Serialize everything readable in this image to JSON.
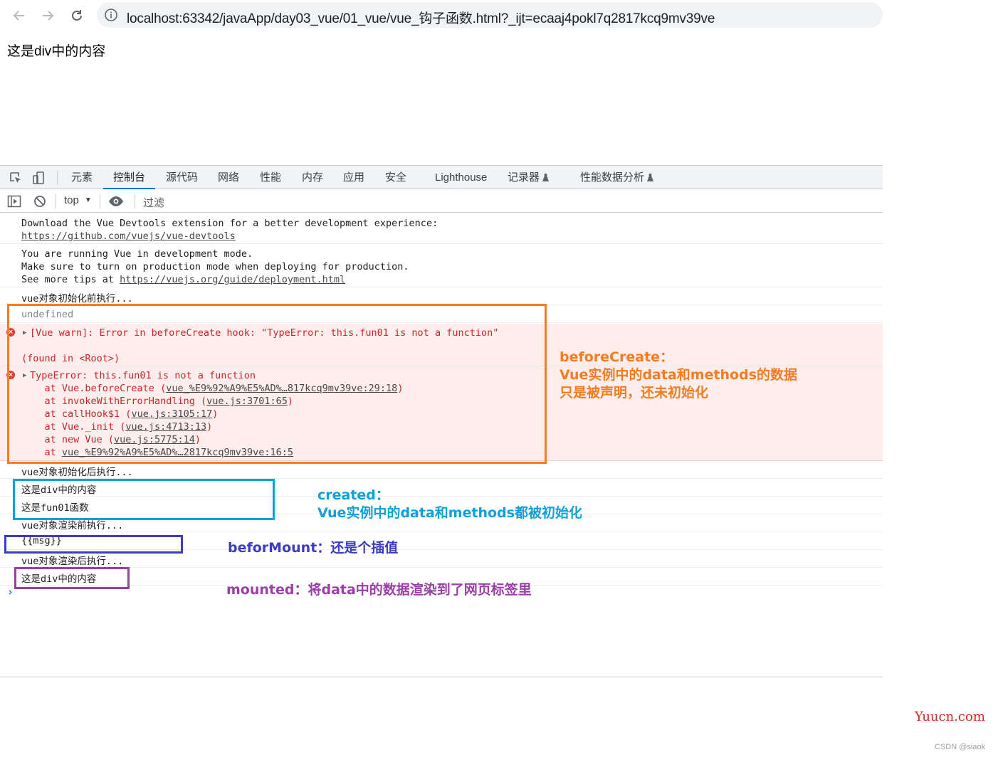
{
  "browser": {
    "url": "localhost:63342/javaApp/day03_vue/01_vue/vue_钩子函数.html?_ijt=ecaaj4pokl7q2817kcq9mv39ve"
  },
  "page": {
    "content": "这是div中的内容"
  },
  "devtools": {
    "tabs": [
      {
        "label": "元素"
      },
      {
        "label": "控制台"
      },
      {
        "label": "源代码"
      },
      {
        "label": "网络"
      },
      {
        "label": "性能"
      },
      {
        "label": "内存"
      },
      {
        "label": "应用"
      },
      {
        "label": "安全"
      },
      {
        "label": "Lighthouse"
      },
      {
        "label": "记录器"
      },
      {
        "label": "性能数据分析"
      }
    ],
    "active_tab": "控制台",
    "context": "top",
    "filter_placeholder": "过滤"
  },
  "console": {
    "devtools_msg": {
      "line1": "Download the Vue Devtools extension for a better development experience:",
      "link": "https://github.com/vuejs/vue-devtools"
    },
    "devmode_msg": {
      "line1": "You are running Vue in development mode.",
      "line2": "Make sure to turn on production mode when deploying for production.",
      "line3_prefix": "See more tips at ",
      "link": "https://vuejs.org/guide/deployment.html"
    },
    "before_create_log": "vue对象初始化前执行...",
    "undefined_log": "undefined",
    "warn": {
      "line1": "[Vue warn]: Error in beforeCreate hook: \"TypeError: this.fun01 is not a function\"",
      "line2": "(found in <Root>)"
    },
    "type_error": {
      "title": "TypeError: this.fun01 is not a function",
      "stack": [
        {
          "prefix": "    at Vue.beforeCreate (",
          "link": "vue_%E9%92%A9%E5%AD%…817kcq9mv39ve:29:18",
          "suffix": ")"
        },
        {
          "prefix": "    at invokeWithErrorHandling (",
          "link": "vue.js:3701:65",
          "suffix": ")"
        },
        {
          "prefix": "    at callHook$1 (",
          "link": "vue.js:3105:17",
          "suffix": ")"
        },
        {
          "prefix": "    at Vue._init (",
          "link": "vue.js:4713:13",
          "suffix": ")"
        },
        {
          "prefix": "    at new Vue (",
          "link": "vue.js:5775:14",
          "suffix": ")"
        },
        {
          "prefix": "    at ",
          "link": "vue_%E9%92%A9%E5%AD%…2817kcq9mv39ve:16:5",
          "suffix": ""
        }
      ]
    },
    "created_log": "vue对象初始化后执行...",
    "created_msg": "这是div中的内容",
    "created_fun": "这是fun01函数",
    "before_mount_log": "vue对象渲染前执行...",
    "before_mount_msg": "{{msg}}",
    "mounted_log": "vue对象渲染后执行...",
    "mounted_msg": "这是div中的内容"
  },
  "annotations": {
    "before_create": {
      "line1": "beforeCreate：",
      "line2": "Vue实例中的data和methods的数据",
      "line3": "只是被声明，还未初始化",
      "color": "#f57c1f"
    },
    "created": {
      "line1": "created：",
      "line2": "Vue实例中的data和methods都被初始化",
      "color": "#0fa0d8"
    },
    "befor_mount": {
      "text": "beforMount：还是个插值",
      "color": "#3c3cc2"
    },
    "mounted": {
      "text": "mounted：将data中的数据渲染到了网页标签里",
      "color": "#9a3fa5"
    }
  },
  "watermark": "Yuucn.com",
  "credit": "CSDN @siaok"
}
